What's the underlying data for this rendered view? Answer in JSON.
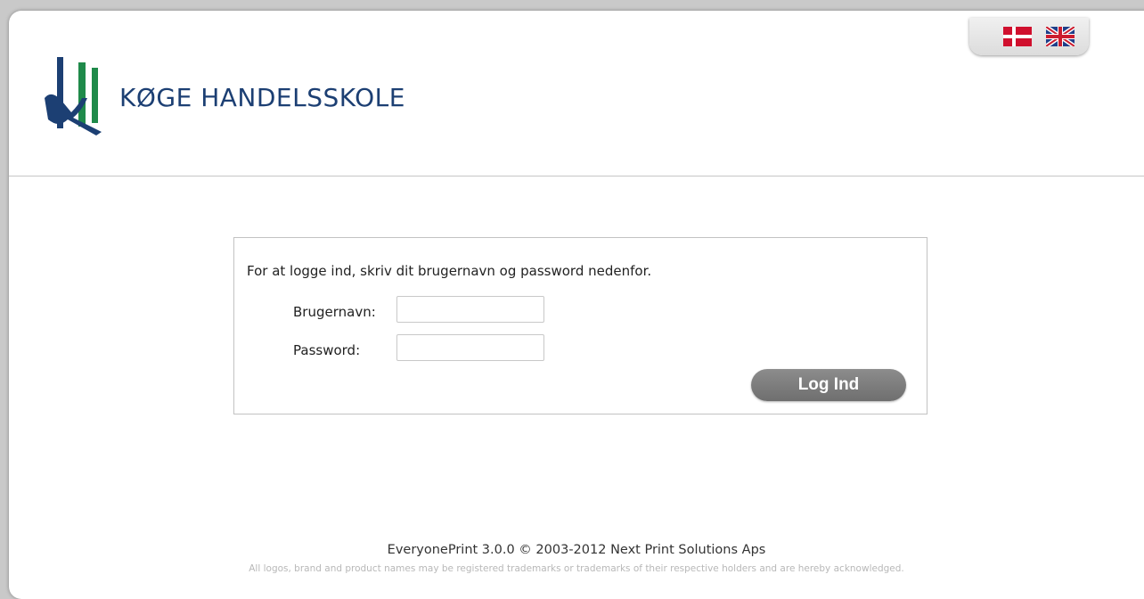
{
  "header": {
    "logo_text": "KØGE HANDELSSKOLE",
    "brand_colors": {
      "blue": "#1c3f73",
      "green": "#1f8a4a"
    },
    "languages": [
      {
        "name": "danish-flag-icon",
        "code": "DK"
      },
      {
        "name": "uk-flag-icon",
        "code": "GB"
      }
    ]
  },
  "login": {
    "intro": "For at logge ind, skriv dit brugernavn og password nedenfor.",
    "username_label": "Brugernavn:",
    "username_value": "",
    "password_label": "Password:",
    "password_value": "",
    "submit_label": "Log Ind",
    "button_color": "#7d7d7d"
  },
  "footer": {
    "product": "EveryonePrint 3.0.0 © 2003-2012 Next Print Solutions Aps",
    "legal": "All logos, brand and product names may be registered trademarks or trademarks of their respective holders and are hereby acknowledged."
  }
}
